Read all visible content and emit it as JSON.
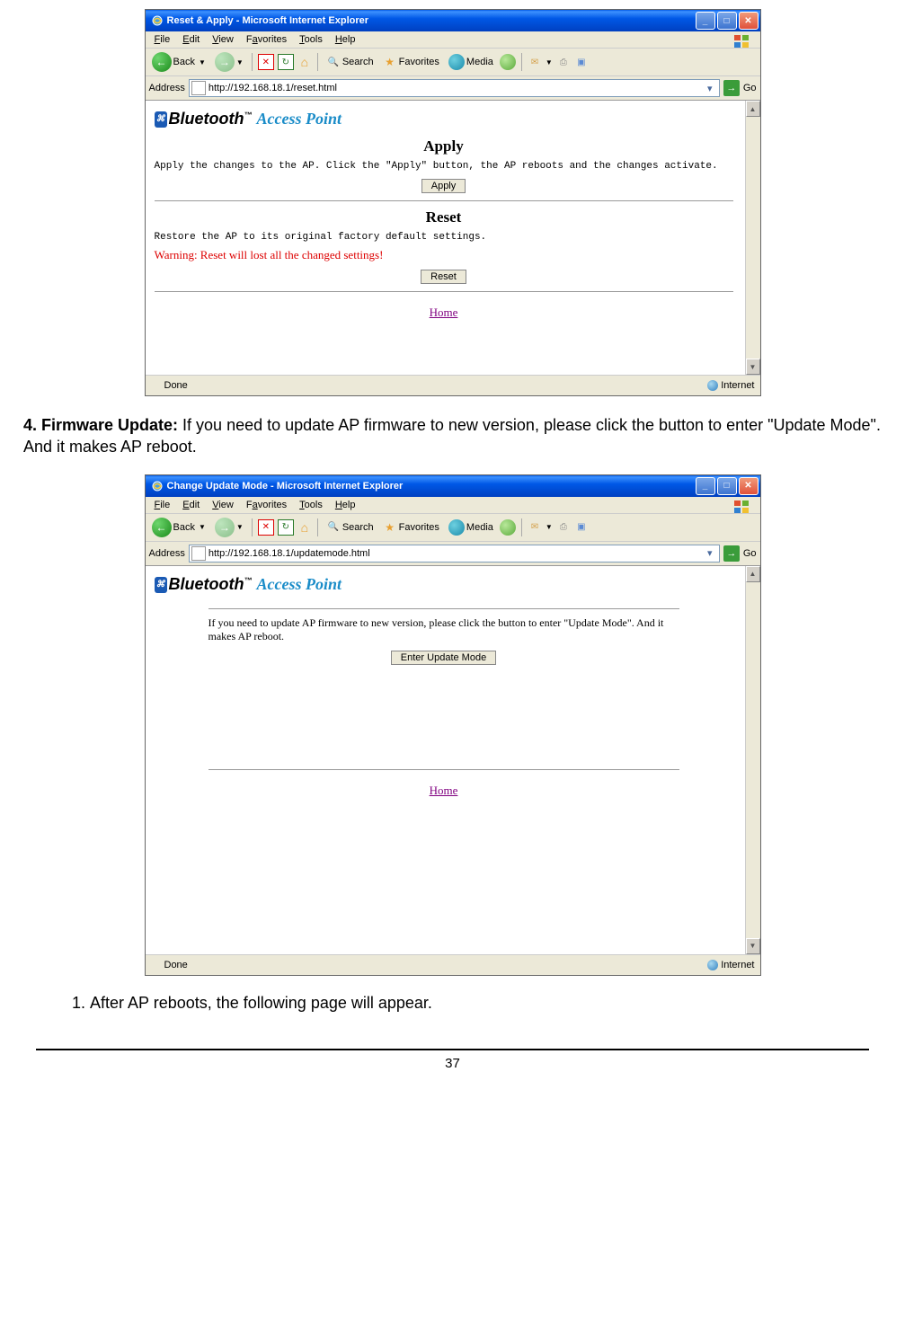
{
  "doc": {
    "firmware_heading": "4. Firmware Update:",
    "firmware_text": " If you need to update AP firmware to new version, please click the button to enter \"Update Mode\". And it makes AP reboot.",
    "step1": "After AP reboots, the following page will appear.",
    "page_number": "37"
  },
  "window1": {
    "title": "Reset & Apply - Microsoft Internet Explorer",
    "menu": {
      "file": "File",
      "edit": "Edit",
      "view": "View",
      "fav": "Favorites",
      "tools": "Tools",
      "help": "Help"
    },
    "toolbar": {
      "back": "Back",
      "search": "Search",
      "favorites": "Favorites",
      "media": "Media"
    },
    "address_label": "Address",
    "address_url": "http://192.168.18.1/reset.html",
    "go": "Go",
    "logo": {
      "bt": "Bluetooth",
      "tm": "™",
      "ap": "Access Point"
    },
    "apply": {
      "title": "Apply",
      "text": "Apply the changes to the AP. Click the \"Apply\" button, the AP reboots and the changes activate.",
      "button": "Apply"
    },
    "reset": {
      "title": "Reset",
      "text": "Restore the AP to its original factory default settings.",
      "warning": "Warning: Reset will lost all the changed settings!",
      "button": "Reset"
    },
    "home_link": "Home",
    "status_done": "Done",
    "status_zone": "Internet"
  },
  "window2": {
    "title": "Change Update Mode - Microsoft Internet Explorer",
    "address_url": "http://192.168.18.1/updatemode.html",
    "content_text": "If you need to update AP firmware to new version, please click the button to enter \"Update Mode\". And it makes AP  reboot.",
    "button": "Enter Update Mode",
    "home_link": "Home"
  }
}
